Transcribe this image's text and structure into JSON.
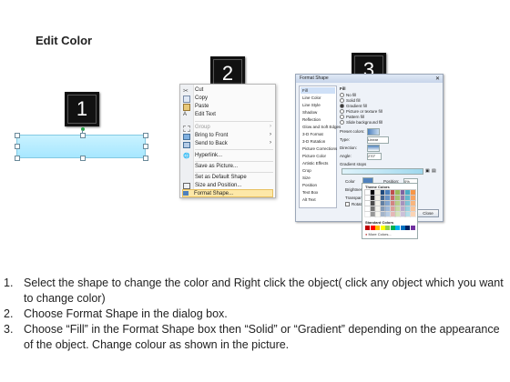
{
  "title": "Edit Color",
  "callouts": [
    "1",
    "2",
    "3"
  ],
  "context_menu": {
    "items": [
      {
        "label": "Cut",
        "icon": "scissors-icon",
        "disabled": false
      },
      {
        "label": "Copy",
        "icon": "copy-icon",
        "disabled": false
      },
      {
        "label": "Paste",
        "icon": "paste-icon",
        "disabled": false
      },
      {
        "label": "Edit Text",
        "icon": "edit-text-icon",
        "disabled": false
      },
      {
        "label": "Group",
        "icon": "group-icon",
        "disabled": true,
        "submenu": true
      },
      {
        "label": "Bring to Front",
        "icon": "bring-front-icon",
        "disabled": false,
        "submenu": true
      },
      {
        "label": "Send to Back",
        "icon": "send-back-icon",
        "disabled": false,
        "submenu": true
      },
      {
        "label": "Hyperlink...",
        "icon": "hyperlink-icon",
        "disabled": false
      },
      {
        "label": "Save as Picture...",
        "icon": "",
        "disabled": false
      },
      {
        "label": "Set as Default Shape",
        "icon": "",
        "disabled": false
      },
      {
        "label": "Size and Position...",
        "icon": "size-icon",
        "disabled": false
      },
      {
        "label": "Format Shape...",
        "icon": "format-shape-icon",
        "disabled": false,
        "highlighted": true
      }
    ]
  },
  "format_dialog": {
    "title": "Format Shape",
    "categories": [
      "Fill",
      "Line Color",
      "Line Style",
      "Shadow",
      "Reflection",
      "Glow and Soft Edges",
      "3-D Format",
      "3-D Rotation",
      "Picture Corrections",
      "Picture Color",
      "Artistic Effects",
      "Crop",
      "Size",
      "Position",
      "Text Box",
      "Alt Text"
    ],
    "fill_heading": "Fill",
    "fill_options": [
      {
        "label": "No fill",
        "selected": false
      },
      {
        "label": "Solid fill",
        "selected": false
      },
      {
        "label": "Gradient fill",
        "selected": true
      },
      {
        "label": "Picture or texture fill",
        "selected": false
      },
      {
        "label": "Pattern fill",
        "selected": false
      },
      {
        "label": "Slide background fill",
        "selected": false
      }
    ],
    "preset_colors_label": "Preset colors:",
    "type_label": "Type:",
    "type_value": "Linear",
    "direction_label": "Direction:",
    "angle_label": "Angle:",
    "angle_value": "270°",
    "gradient_stops_label": "Gradient stops",
    "color_label": "Color",
    "position_label": "Position:",
    "position_value": "0%",
    "brightness_label": "Brightness:",
    "transparency_label": "Transparency:",
    "rotate_label": "Rotate with shape",
    "close_label": "Close",
    "theme_colors_label": "Theme Colors",
    "standard_colors_label": "Standard Colors",
    "more_colors_label": "More Colors...",
    "theme_colors": [
      "#ffffff",
      "#000000",
      "#eeece1",
      "#1f497d",
      "#4f81bd",
      "#c0504d",
      "#9bbb59",
      "#8064a2",
      "#4bacc6",
      "#f79646"
    ],
    "standard_colors": [
      "#c00000",
      "#ff0000",
      "#ffc000",
      "#ffff00",
      "#92d050",
      "#00b050",
      "#00b0f0",
      "#0070c0",
      "#002060",
      "#7030a0"
    ]
  },
  "instructions": [
    {
      "num": "1.",
      "text": "Select the shape to change the color and Right click the object( click any object which you want to change color)"
    },
    {
      "num": "2.",
      "text": "Choose Format Shape in the dialog box."
    },
    {
      "num": "3.",
      "text": "Choose “Fill” in the Format Shape box then “Solid” or “Gradient” depending on the appearance of the object. Change colour as shown in the picture."
    }
  ]
}
